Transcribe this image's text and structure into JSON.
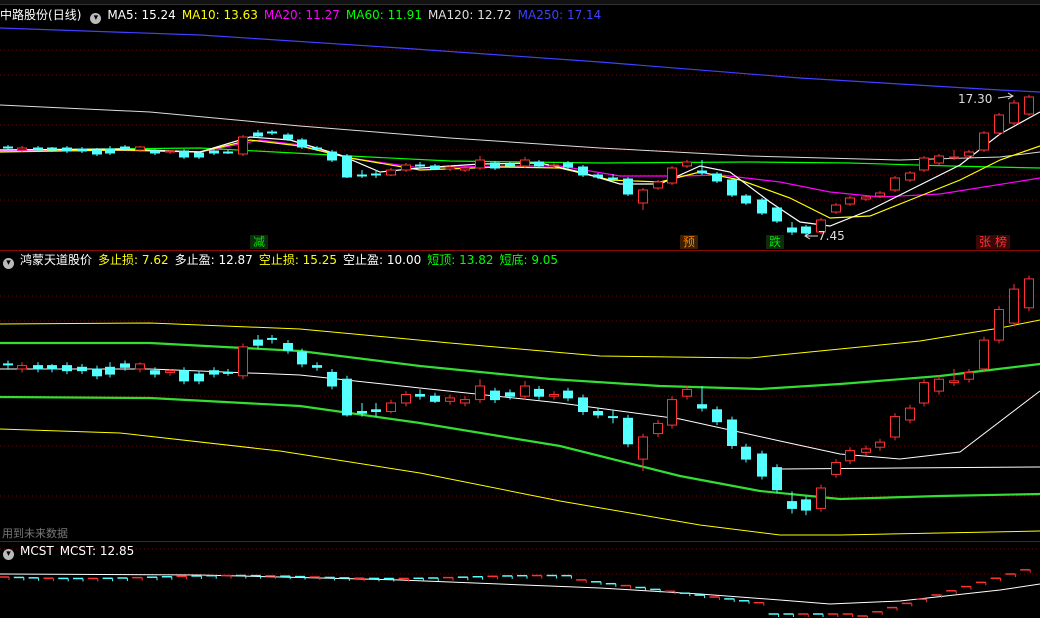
{
  "main": {
    "title": "中路股份",
    "period": "(日线)",
    "ma": [
      {
        "label": "MA5: 15.24",
        "color": "#ffffff"
      },
      {
        "label": "MA10: 13.63",
        "color": "#ffff00"
      },
      {
        "label": "MA20: 11.27",
        "color": "#ff00ff"
      },
      {
        "label": "MA60: 11.91",
        "color": "#00ff00"
      },
      {
        "label": "MA120: 12.72",
        "color": "#dddddd"
      },
      {
        "label": "MA250: 17.14",
        "color": "#4040ff"
      }
    ],
    "high_label": "17.30",
    "low_label": "7.45",
    "signals": [
      {
        "text": "减",
        "color": "#00c000"
      },
      {
        "text": "预",
        "color": "#ff8000"
      },
      {
        "text": "跌",
        "color": "#00c000"
      },
      {
        "text": "张",
        "color": "#ff3030"
      },
      {
        "text": "榜",
        "color": "#ff3030"
      }
    ]
  },
  "indicator": {
    "title": "鸿蒙天道股价",
    "items": [
      {
        "label": "多止损: 7.62",
        "color": "#ffff00"
      },
      {
        "label": "多止盈: 12.87",
        "color": "#ffffff"
      },
      {
        "label": "空止损: 15.25",
        "color": "#ffff00"
      },
      {
        "label": "空止盈: 10.00",
        "color": "#ffffff"
      },
      {
        "label": "短顶: 13.82",
        "color": "#00ff00"
      },
      {
        "label": "短底: 9.05",
        "color": "#00ff00"
      }
    ],
    "footnote": "用到未来数据"
  },
  "mcst": {
    "title": "MCST",
    "value_label": "MCST: 12.85"
  },
  "colors": {
    "up": "#ff3232",
    "down": "#54ffff",
    "ma5": "#ffffff",
    "ma10": "#ffff00",
    "ma20": "#ff00ff",
    "ma60": "#00ff00",
    "ma120": "#dddddd",
    "ma250": "#4040ff",
    "grid": "#7a0000"
  }
}
